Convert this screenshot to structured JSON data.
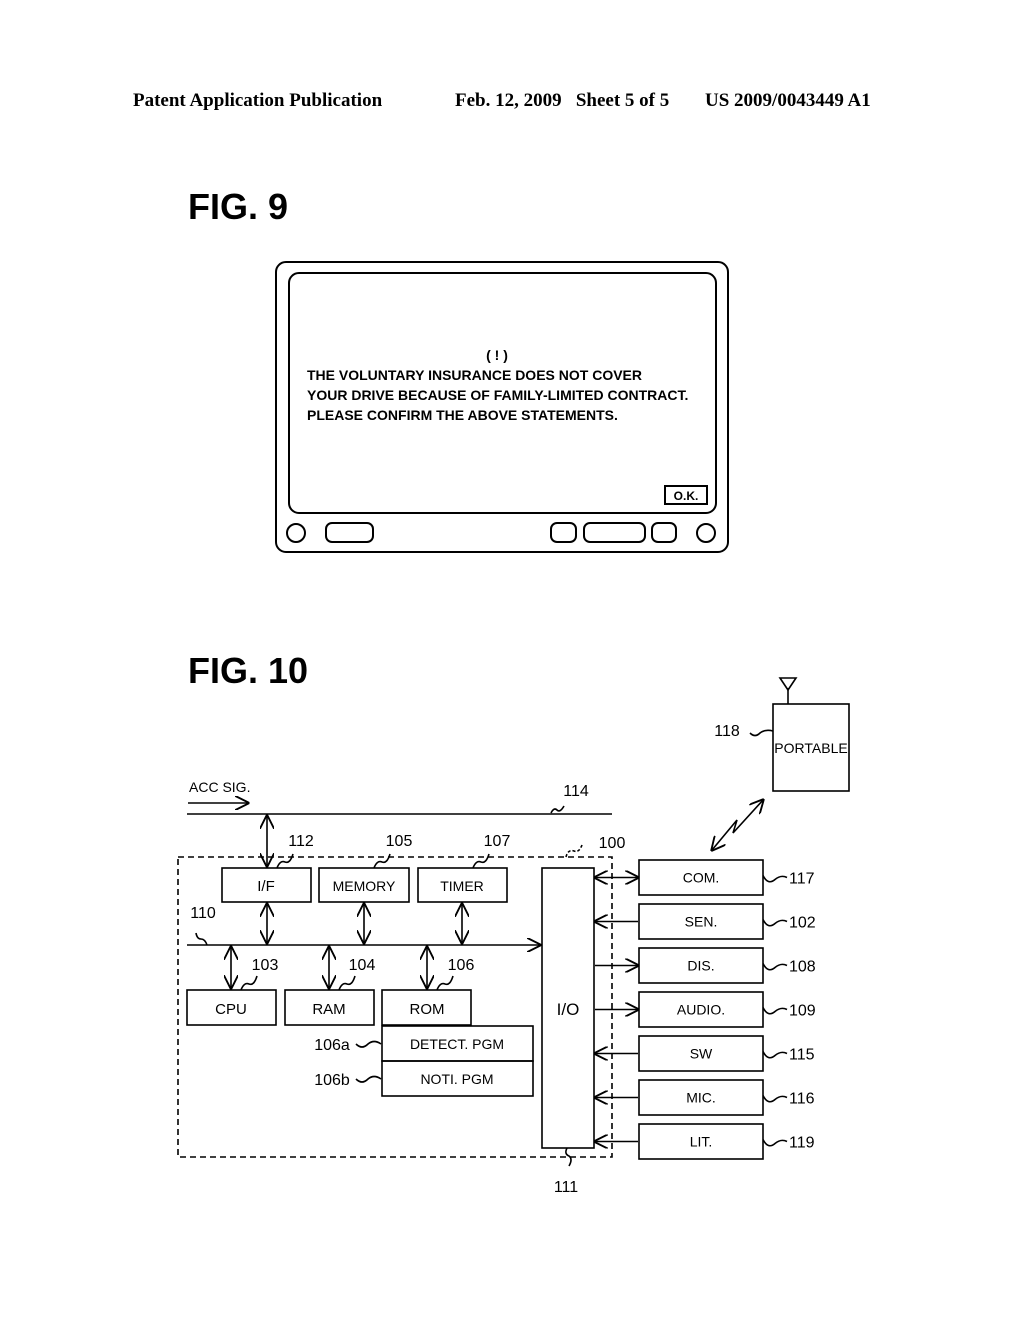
{
  "header": {
    "left": "Patent Application Publication",
    "date_sheet": "Feb. 12, 2009   Sheet 5 of 5",
    "number": "US 2009/0043449 A1"
  },
  "fig9": {
    "label": "FIG. 9",
    "screen": {
      "alert_symbol": "( ! )",
      "lines": [
        "THE VOLUNTARY INSURANCE DOES NOT COVER",
        "YOUR DRIVE BECAUSE OF FAMILY-LIMITED CONTRACT.",
        "PLEASE CONFIRM THE ABOVE STATEMENTS."
      ],
      "ok_button": "O.K."
    }
  },
  "fig10": {
    "label": "FIG. 10",
    "acc_sig": "ACC SIG.",
    "refs": {
      "line114": "114",
      "unit100": "100",
      "bus110": "110",
      "io111": "111",
      "portable118": "118"
    },
    "blocks": {
      "if": {
        "label": "I/F",
        "ref": "112"
      },
      "memory": {
        "label": "MEMORY",
        "ref": "105"
      },
      "timer": {
        "label": "TIMER",
        "ref": "107"
      },
      "cpu": {
        "label": "CPU",
        "ref": "103"
      },
      "ram": {
        "label": "RAM",
        "ref": "104"
      },
      "rom": {
        "label": "ROM",
        "ref": "106"
      },
      "detect": {
        "label": "DETECT. PGM",
        "ref": "106a"
      },
      "noti": {
        "label": "NOTI. PGM",
        "ref": "106b"
      },
      "io": {
        "label": "I/O"
      },
      "portable": {
        "label": "PORTABLE"
      }
    },
    "peripherals": [
      {
        "label": "COM.",
        "ref": "117",
        "dir": "both"
      },
      {
        "label": "SEN.",
        "ref": "102",
        "dir": "in"
      },
      {
        "label": "DIS.",
        "ref": "108",
        "dir": "out"
      },
      {
        "label": "AUDIO.",
        "ref": "109",
        "dir": "out"
      },
      {
        "label": "SW",
        "ref": "115",
        "dir": "in"
      },
      {
        "label": "MIC.",
        "ref": "116",
        "dir": "in"
      },
      {
        "label": "LIT.",
        "ref": "119",
        "dir": "in"
      }
    ]
  }
}
